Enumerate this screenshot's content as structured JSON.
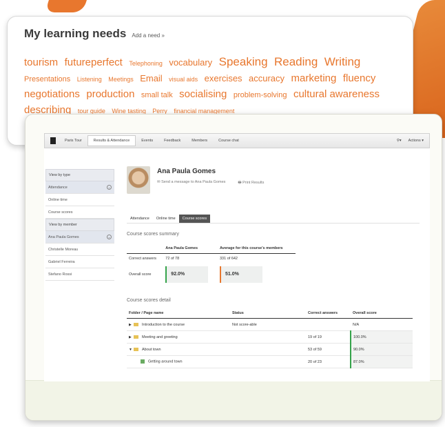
{
  "colors": {
    "accent": "#e8772e",
    "green": "#34a34a"
  },
  "needs": {
    "title": "My learning needs",
    "add_link": "Add a need »",
    "tags": [
      {
        "text": "tourism",
        "size": 4
      },
      {
        "text": "futureperfect",
        "size": 4
      },
      {
        "text": "Telephoning",
        "size": 1
      },
      {
        "text": "vocabulary",
        "size": 3
      },
      {
        "text": "Speaking",
        "size": 5
      },
      {
        "text": "Reading",
        "size": 5
      },
      {
        "text": "Writing",
        "size": 5
      },
      {
        "text": "Presentations",
        "size": 2
      },
      {
        "text": "Listening",
        "size": 1
      },
      {
        "text": "Meetings",
        "size": 1
      },
      {
        "text": "Email",
        "size": 3
      },
      {
        "text": "visual aids",
        "size": 1
      },
      {
        "text": "exercises",
        "size": 3
      },
      {
        "text": "accuracy",
        "size": 3
      },
      {
        "text": "marketing",
        "size": 4
      },
      {
        "text": "fluency",
        "size": 4
      },
      {
        "text": "negotiations",
        "size": 4
      },
      {
        "text": "production",
        "size": 4
      },
      {
        "text": "small talk",
        "size": 2
      },
      {
        "text": "socialising",
        "size": 4
      },
      {
        "text": "problem-solving",
        "size": 2
      },
      {
        "text": "cultural awareness",
        "size": 4
      },
      {
        "text": "describing",
        "size": 4
      },
      {
        "text": "tour guide",
        "size": 1
      },
      {
        "text": "Wine tasting",
        "size": 1
      },
      {
        "text": "Perry",
        "size": 1
      },
      {
        "text": "financial management",
        "size": 1
      }
    ]
  },
  "app": {
    "nav": {
      "course": "Paris Tour",
      "tabs": [
        "Results & Attendance",
        "Events",
        "Feedback",
        "Members",
        "Course chat"
      ],
      "actions": "Actions"
    },
    "sidebar": {
      "items": [
        {
          "label": "View by type",
          "kind": "head"
        },
        {
          "label": "Attendance",
          "kind": "sel"
        },
        {
          "label": "Online time",
          "kind": "item"
        },
        {
          "label": "Course scores",
          "kind": "item"
        },
        {
          "label": "View by member",
          "kind": "head"
        },
        {
          "label": "Ana Paula Gomes",
          "kind": "sel"
        },
        {
          "label": "Christelle Moreau",
          "kind": "item"
        },
        {
          "label": "Gabriel Ferreira",
          "kind": "item"
        },
        {
          "label": "Stefano Rossi",
          "kind": "item"
        }
      ]
    },
    "profile": {
      "name": "Ana Paula Gomes",
      "message": "Send a message to Ana Paula Gomes",
      "print": "Print Results"
    },
    "subtabs": [
      "Attendance",
      "Online time",
      "Course scores"
    ],
    "summary": {
      "title": "Course scores summary",
      "col_member": "Ana Paula Gomes",
      "col_average": "Average for this course's members",
      "row1_label": "Correct answers",
      "row1_member": "72 of 78",
      "row1_average": "331 of 642",
      "row2_label": "Overall score",
      "row2_member": "92.0%",
      "row2_average": "51.0%"
    },
    "detail": {
      "title": "Course scores detail",
      "headers": [
        "Folder / Page name",
        "Status",
        "Correct answers",
        "Overall score"
      ],
      "rows": [
        {
          "name": "Introduction to the course",
          "status": "Not score-able",
          "correct": "",
          "score": "N/A",
          "arrow": "▶",
          "type": "folder"
        },
        {
          "name": "Meeting and greeting",
          "status": "",
          "correct": "19 of 19",
          "score": "100.0%",
          "arrow": "▶",
          "type": "folder"
        },
        {
          "name": "About town",
          "status": "",
          "correct": "53 of 59",
          "score": "90.0%",
          "arrow": "▼",
          "type": "folder"
        },
        {
          "name": "Getting around town",
          "status": "",
          "correct": "20 of 23",
          "score": "87.0%",
          "arrow": "",
          "type": "page"
        }
      ]
    }
  }
}
